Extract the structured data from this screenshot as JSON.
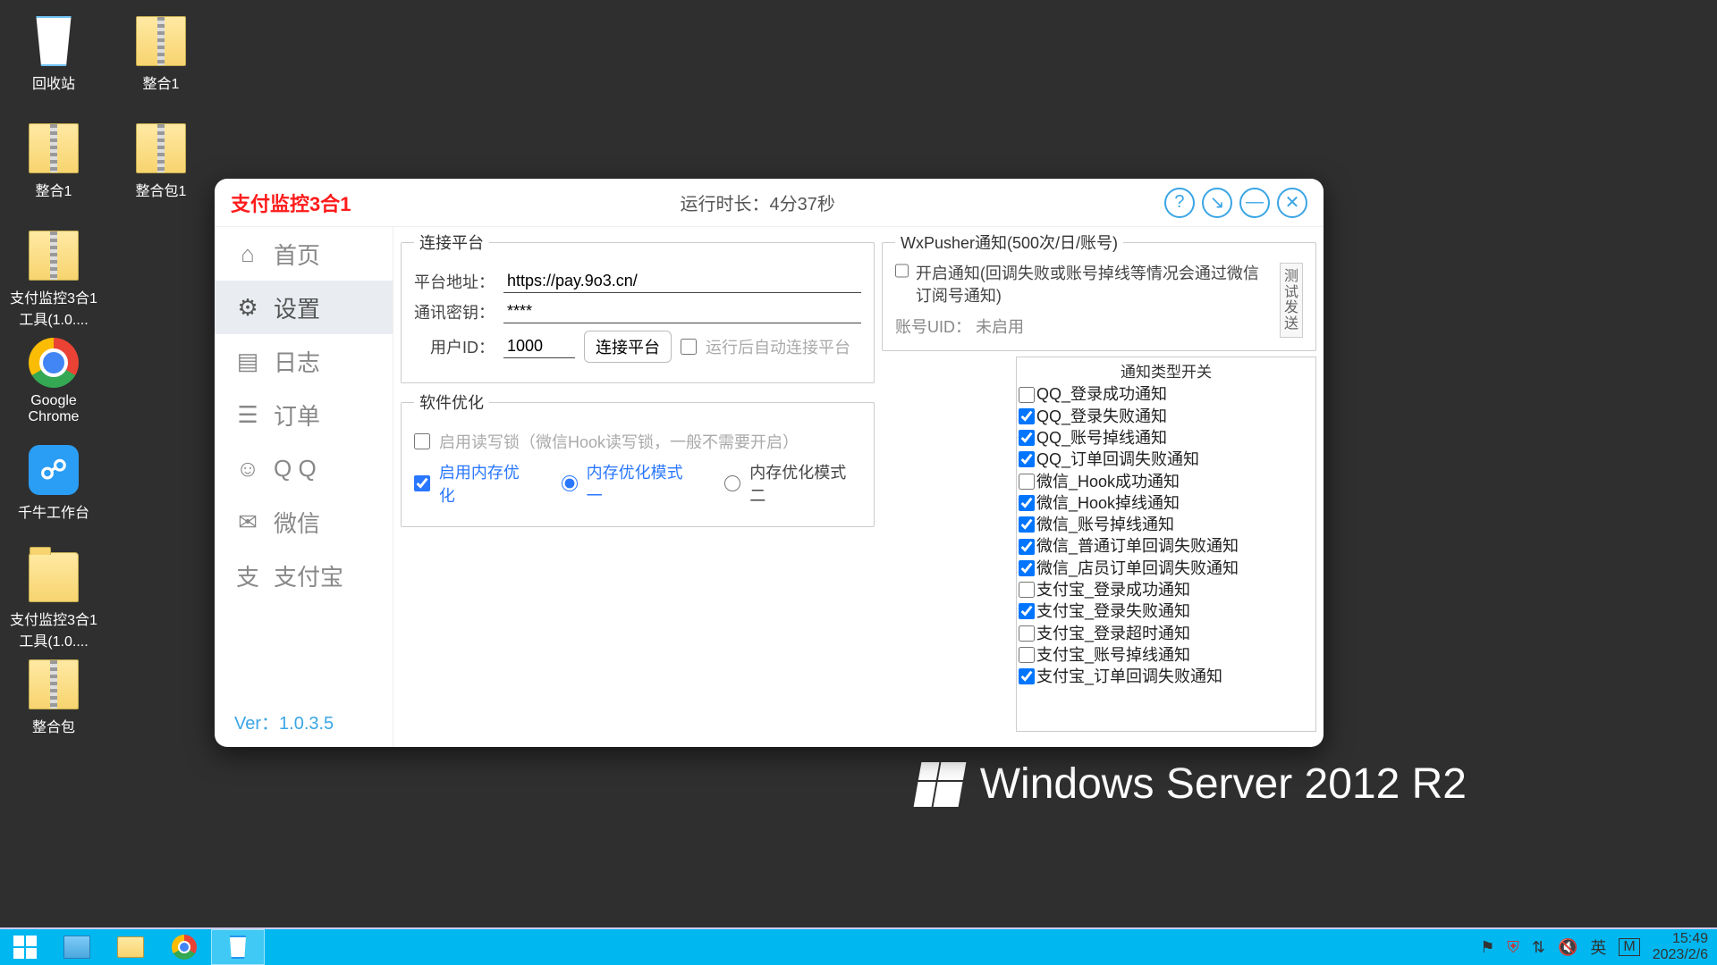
{
  "desktop": {
    "wallpaper_brand": "Windows Server 2012 R2",
    "icons": [
      {
        "type": "recycle",
        "label": "回收站"
      },
      {
        "type": "zip",
        "label": "整合1"
      },
      {
        "type": "zip",
        "label": "支付监控3合1工具(1.0...."
      },
      {
        "type": "chrome",
        "label": "Google Chrome"
      },
      {
        "type": "qianniu",
        "label": "千牛工作台"
      },
      {
        "type": "folder",
        "label": "支付监控3合1工具(1.0...."
      },
      {
        "type": "zip",
        "label": "整合包"
      },
      {
        "type": "zip",
        "label": "整合1"
      },
      {
        "type": "zip",
        "label": "整合包1"
      }
    ]
  },
  "app": {
    "title": "支付监控3合1",
    "runtime_label": "运行时长：4分37秒",
    "version": "Ver：1.0.3.5",
    "nav": [
      {
        "icon": "⌂",
        "label": "首页"
      },
      {
        "icon": "⚙",
        "label": "设置"
      },
      {
        "icon": "▤",
        "label": "日志"
      },
      {
        "icon": "☰",
        "label": "订单"
      },
      {
        "icon": "☺",
        "label": "Q Q"
      },
      {
        "icon": "✉",
        "label": "微信"
      },
      {
        "icon": "支",
        "label": "支付宝"
      }
    ],
    "active_nav_index": 1,
    "connect": {
      "legend": "连接平台",
      "addr_label": "平台地址：",
      "addr": "https://pay.9o3.cn/",
      "secret_label": "通讯密钥：",
      "secret": "****",
      "userid_label": "用户ID：",
      "userid": "1000",
      "connect_btn": "连接平台",
      "auto_connect": "运行后自动连接平台",
      "auto_connect_checked": false
    },
    "optimize": {
      "legend": "软件优化",
      "lock_label": "启用读写锁（微信Hook读写锁，一般不需要开启）",
      "lock_checked": false,
      "mem_enable_label": "启用内存优化",
      "mem_enable_checked": true,
      "mode1_label": "内存优化模式一",
      "mode2_label": "内存优化模式二",
      "mode_selected": 1
    },
    "wxpusher": {
      "legend": "WxPusher通知(500次/日/账号)",
      "enable_label": "开启通知(回调失败或账号掉线等情况会通过微信订阅号通知)",
      "enable_checked": false,
      "uid_label": "账号UID：",
      "uid_value": "未启用",
      "test_btn": "测试发送"
    },
    "switches": {
      "title": "通知类型开关",
      "items": [
        {
          "label": "QQ_登录成功通知",
          "checked": false
        },
        {
          "label": "QQ_登录失败通知",
          "checked": true
        },
        {
          "label": "QQ_账号掉线通知",
          "checked": true
        },
        {
          "label": "QQ_订单回调失败通知",
          "checked": true
        },
        {
          "label": "微信_Hook成功通知",
          "checked": false
        },
        {
          "label": "微信_Hook掉线通知",
          "checked": true
        },
        {
          "label": "微信_账号掉线通知",
          "checked": true
        },
        {
          "label": "微信_普通订单回调失败通知",
          "checked": true
        },
        {
          "label": "微信_店员订单回调失败通知",
          "checked": true
        },
        {
          "label": "支付宝_登录成功通知",
          "checked": false
        },
        {
          "label": "支付宝_登录失败通知",
          "checked": true
        },
        {
          "label": "支付宝_登录超时通知",
          "checked": false
        },
        {
          "label": "支付宝_账号掉线通知",
          "checked": false
        },
        {
          "label": "支付宝_订单回调失败通知",
          "checked": true
        }
      ]
    }
  },
  "taskbar": {
    "tray": {
      "ime_lang": "英",
      "ime_mode": "M",
      "time": "15:49",
      "date": "2023/2/6"
    }
  }
}
